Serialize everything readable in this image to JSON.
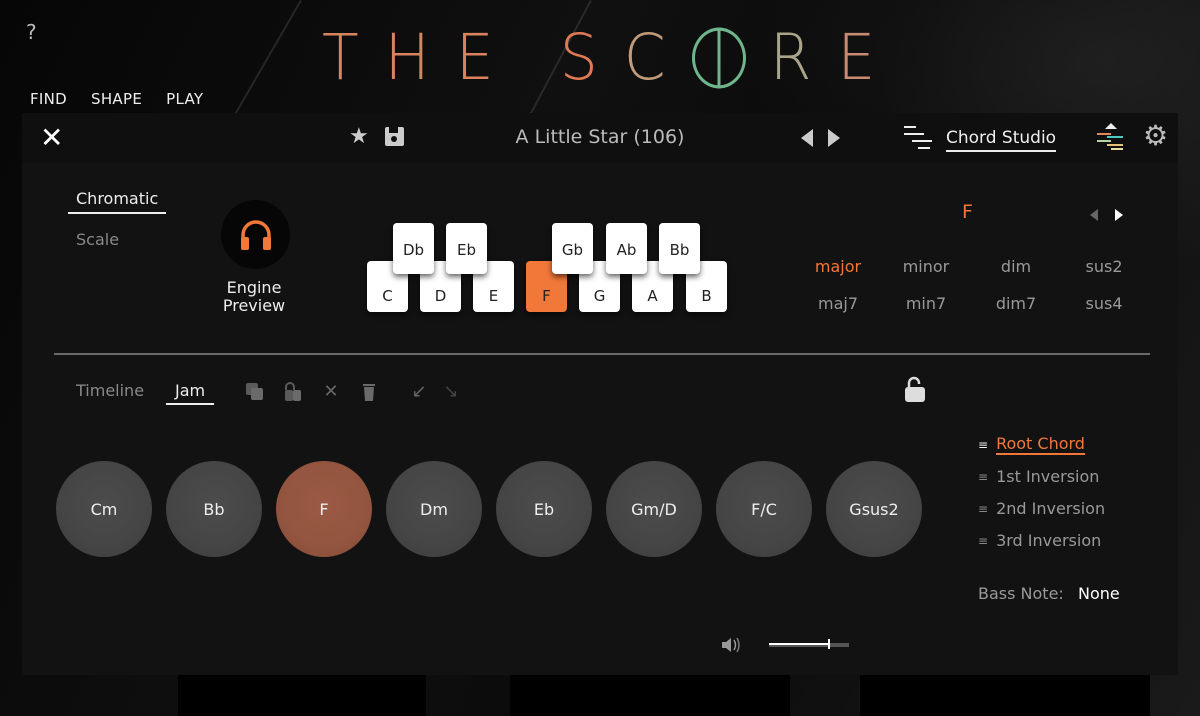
{
  "app": {
    "help_label": "?",
    "logo_left": "THE",
    "logo_right_letters": [
      "S",
      "C",
      "R",
      "E"
    ],
    "nav": [
      "FIND",
      "SHAPE",
      "PLAY"
    ]
  },
  "header": {
    "close_label": "✕",
    "favorite_icon": "★",
    "preset_name": "A Little Star (106)",
    "studio_name": "Chord Studio",
    "gear_icon": "⚙"
  },
  "mode": {
    "chromatic_label": "Chromatic",
    "scale_label": "Scale",
    "selected": "Chromatic"
  },
  "engine_preview": {
    "label_line1": "Engine",
    "label_line2": "Preview"
  },
  "keyboard": {
    "white_keys": [
      "C",
      "D",
      "E",
      "F",
      "G",
      "A",
      "B"
    ],
    "black_keys": [
      "Db",
      "Eb",
      "Gb",
      "Ab",
      "Bb"
    ],
    "active_key": "F"
  },
  "chord_builder": {
    "root": "F",
    "qualities": [
      "major",
      "minor",
      "dim",
      "sus2",
      "maj7",
      "min7",
      "dim7",
      "sus4"
    ],
    "selected_quality": "major"
  },
  "tabs": {
    "timeline_label": "Timeline",
    "jam_label": "Jam",
    "selected": "Jam"
  },
  "tools": {
    "delete_label": "✕",
    "undo_label": "↙",
    "redo_label": "↘"
  },
  "chords": [
    "Cm",
    "Bb",
    "F",
    "Dm",
    "Eb",
    "Gm/D",
    "F/C",
    "Gsus2"
  ],
  "active_chord": "F",
  "voicings": [
    "Root Chord",
    "1st Inversion",
    "2nd Inversion",
    "3rd Inversion"
  ],
  "selected_voicing": "Root Chord",
  "voicing_grip": "≡",
  "bass_note": {
    "label": "Bass Note:",
    "value": "None"
  },
  "volume": {
    "level_percent": 75
  },
  "colors": {
    "accent": "#f2783a",
    "active_chord": "#93553f",
    "logo_warm": "#d9835f",
    "logo_green": "#6fb58c"
  }
}
